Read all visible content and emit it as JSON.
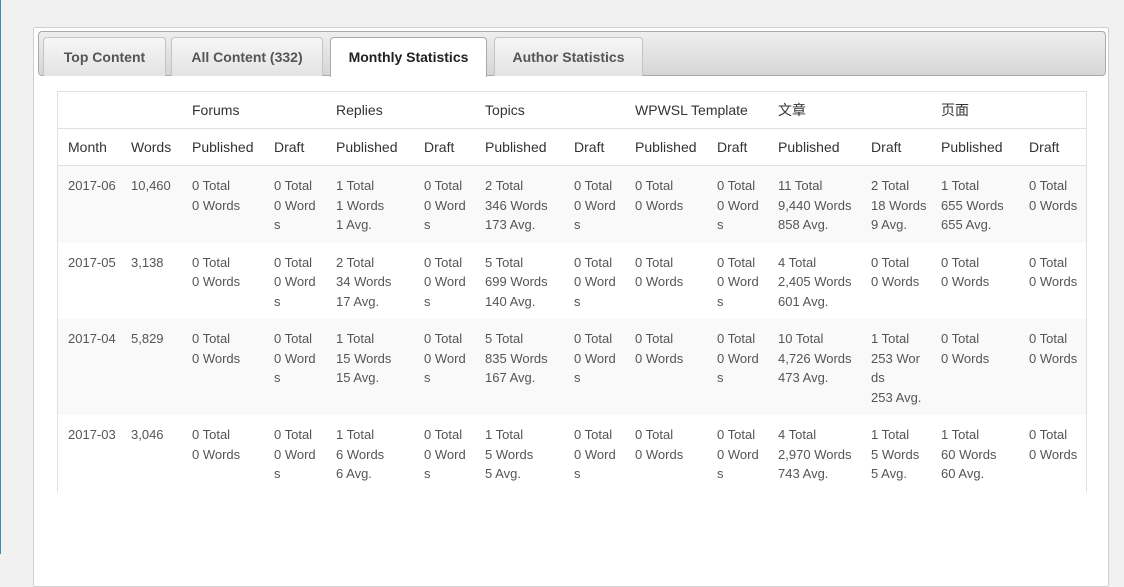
{
  "tabs": [
    {
      "label": "Top Content",
      "active": false
    },
    {
      "label": "All Content (332)",
      "active": false
    },
    {
      "label": "Monthly Statistics",
      "active": true
    },
    {
      "label": "Author Statistics",
      "active": false
    }
  ],
  "table": {
    "groups": [
      "Forums",
      "Replies",
      "Topics",
      "WPWSL Template",
      "文章",
      "页面"
    ],
    "columns": [
      "Month",
      "Words",
      "Published",
      "Draft",
      "Published",
      "Draft",
      "Published",
      "Draft",
      "Published",
      "Draft",
      "Published",
      "Draft",
      "Published",
      "Draft"
    ],
    "rows": [
      {
        "month": "2017-06",
        "words": "10,460",
        "cells": [
          [
            "0 Total",
            "0 Words"
          ],
          [
            "0 Total",
            "0 Words"
          ],
          [
            "1 Total",
            "1 Words",
            "1 Avg."
          ],
          [
            "0 Total",
            "0 Words"
          ],
          [
            "2 Total",
            "346 Words",
            "173 Avg."
          ],
          [
            "0 Total",
            "0 Words"
          ],
          [
            "0 Total",
            "0 Words"
          ],
          [
            "0 Total",
            "0 Words"
          ],
          [
            "11 Total",
            "9,440 Words",
            "858 Avg."
          ],
          [
            "2 Total",
            "18 Words",
            "9 Avg."
          ],
          [
            "1 Total",
            "655 Words",
            "655 Avg."
          ],
          [
            "0 Total",
            "0 Words"
          ]
        ]
      },
      {
        "month": "2017-05",
        "words": "3,138",
        "cells": [
          [
            "0 Total",
            "0 Words"
          ],
          [
            "0 Total",
            "0 Words"
          ],
          [
            "2 Total",
            "34 Words",
            "17 Avg."
          ],
          [
            "0 Total",
            "0 Words"
          ],
          [
            "5 Total",
            "699 Words",
            "140 Avg."
          ],
          [
            "0 Total",
            "0 Words"
          ],
          [
            "0 Total",
            "0 Words"
          ],
          [
            "0 Total",
            "0 Words"
          ],
          [
            "4 Total",
            "2,405 Words",
            "601 Avg."
          ],
          [
            "0 Total",
            "0 Words"
          ],
          [
            "0 Total",
            "0 Words"
          ],
          [
            "0 Total",
            "0 Words"
          ]
        ]
      },
      {
        "month": "2017-04",
        "words": "5,829",
        "cells": [
          [
            "0 Total",
            "0 Words"
          ],
          [
            "0 Total",
            "0 Words"
          ],
          [
            "1 Total",
            "15 Words",
            "15 Avg."
          ],
          [
            "0 Total",
            "0 Words"
          ],
          [
            "5 Total",
            "835 Words",
            "167 Avg."
          ],
          [
            "0 Total",
            "0 Words"
          ],
          [
            "0 Total",
            "0 Words"
          ],
          [
            "0 Total",
            "0 Words"
          ],
          [
            "10 Total",
            "4,726 Words",
            "473 Avg."
          ],
          [
            "1 Total",
            "253 Words",
            "253 Avg."
          ],
          [
            "0 Total",
            "0 Words"
          ],
          [
            "0 Total",
            "0 Words"
          ]
        ]
      },
      {
        "month": "2017-03",
        "words": "3,046",
        "cells": [
          [
            "0 Total",
            "0 Words"
          ],
          [
            "0 Total",
            "0 Words"
          ],
          [
            "1 Total",
            "6 Words",
            "6 Avg."
          ],
          [
            "0 Total",
            "0 Words"
          ],
          [
            "1 Total",
            "5 Words",
            "5 Avg."
          ],
          [
            "0 Total",
            "0 Words"
          ],
          [
            "0 Total",
            "0 Words"
          ],
          [
            "0 Total",
            "0 Words"
          ],
          [
            "4 Total",
            "2,970 Words",
            "743 Avg."
          ],
          [
            "1 Total",
            "5 Words",
            "5 Avg."
          ],
          [
            "1 Total",
            "60 Words",
            "60 Avg."
          ],
          [
            "0 Total",
            "0 Words"
          ]
        ]
      }
    ]
  }
}
